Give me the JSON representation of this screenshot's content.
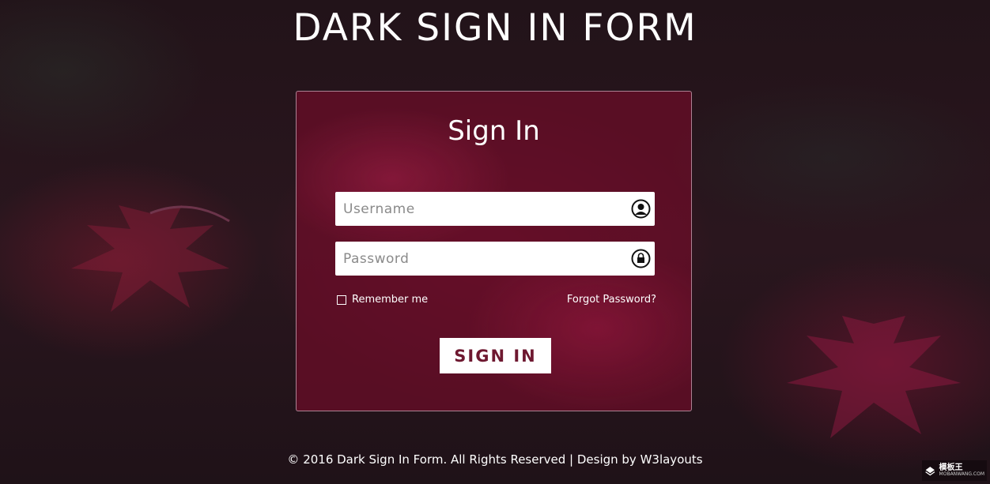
{
  "page": {
    "title": "DARK SIGN IN FORM"
  },
  "form": {
    "title": "Sign In",
    "username_placeholder": "Username",
    "password_placeholder": "Password",
    "remember_label": "Remember me",
    "forgot_label": "Forgot Password?",
    "submit_label": "SIGN IN"
  },
  "icons": {
    "username": "user-icon",
    "password": "lock-icon"
  },
  "footer": {
    "text": "© 2016 Dark Sign In Form. All Rights Reserved | Design by W3layouts"
  },
  "watermark": {
    "name": "模板王",
    "site": "MOBANWANG.COM"
  },
  "colors": {
    "card": "#6e0c28",
    "button_text": "#6e1830",
    "background": "#241419"
  }
}
